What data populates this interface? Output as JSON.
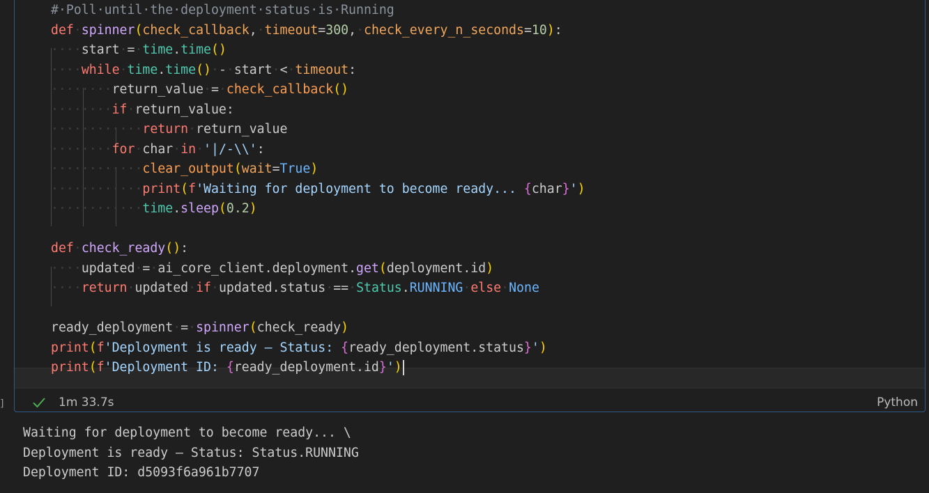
{
  "cell": {
    "language": "Python",
    "execution_time": "1m 33.7s",
    "status": "success",
    "bracket_mark": "]",
    "lines": [
      "# Poll until the deployment status is Running",
      "def spinner(check_callback, timeout=300, check_every_n_seconds=10):",
      "    start = time.time()",
      "    while time.time() - start < timeout:",
      "        return_value = check_callback()",
      "        if return_value:",
      "            return return_value",
      "        for char in '|/-\\\\':",
      "            clear_output(wait=True)",
      "            print(f'Waiting for deployment to become ready... {char}')",
      "            time.sleep(0.2)",
      "",
      "def check_ready():",
      "    updated = ai_core_client.deployment.get(deployment.id)",
      "    return updated if updated.status == Status.RUNNING else None",
      "",
      "ready_deployment = spinner(check_ready)",
      "print(f'Deployment is ready — Status: {ready_deployment.status}')",
      "print(f'Deployment ID: {ready_deployment.id}')"
    ]
  },
  "output": {
    "lines": [
      "Waiting for deployment to become ready... \\",
      "Deployment is ready — Status: Status.RUNNING",
      "Deployment ID: d5093f6a961b7707"
    ]
  },
  "colors": {
    "cell_border": "#2f5a86",
    "background": "#1f1f1f",
    "success_check": "#4caf50"
  }
}
